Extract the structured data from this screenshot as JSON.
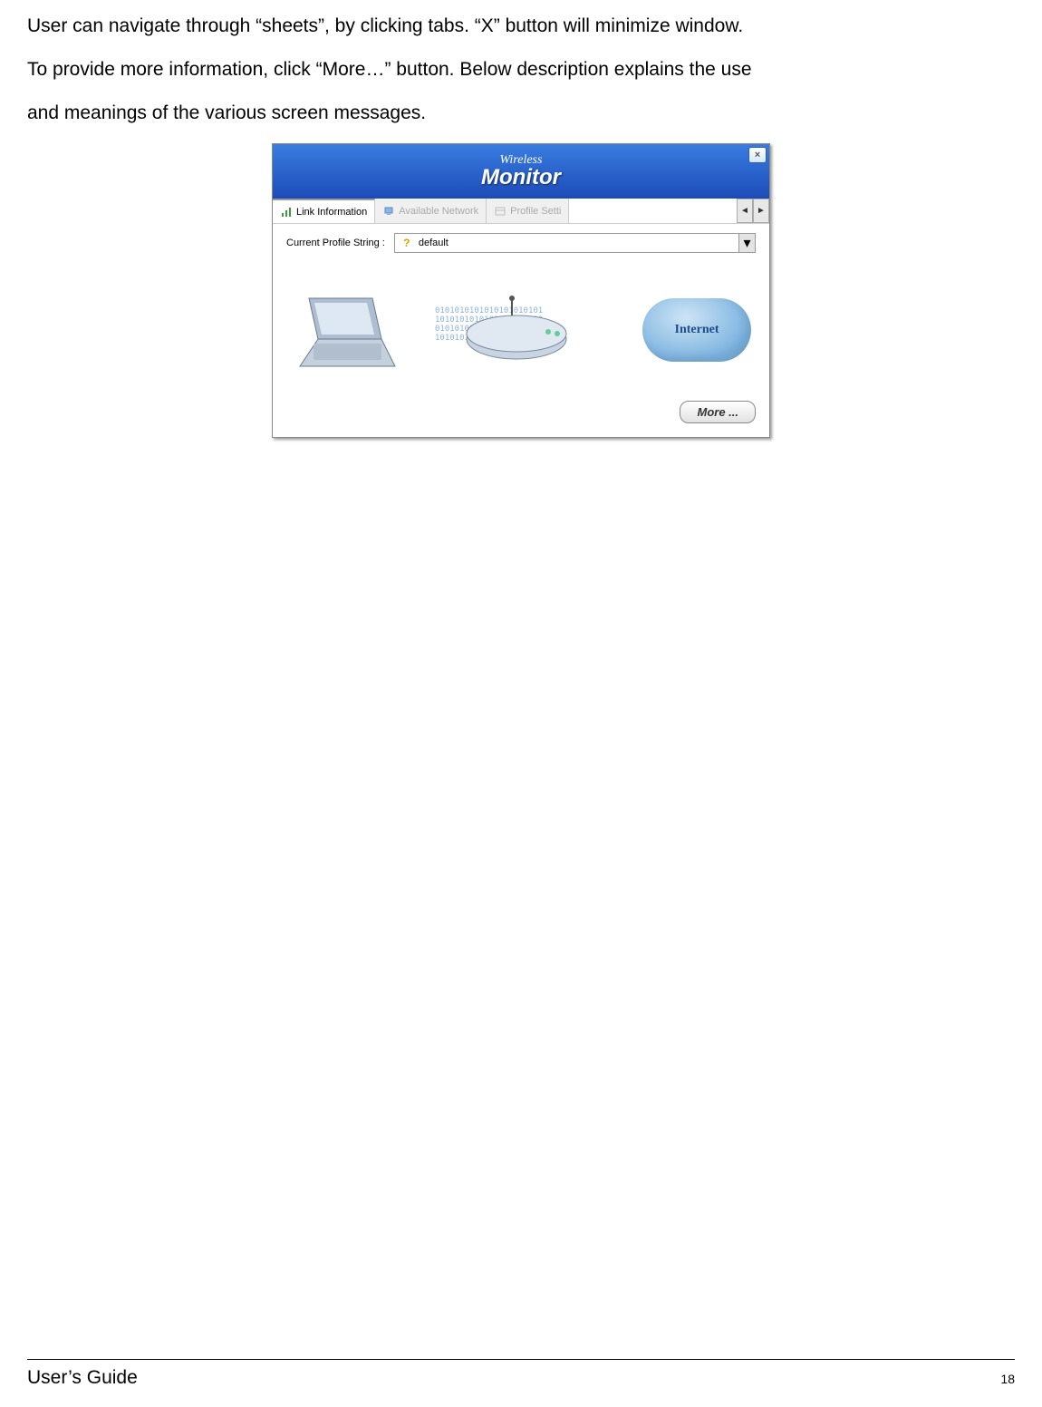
{
  "body": {
    "line1": "User can navigate through “sheets”, by clicking tabs.  “X” button will minimize window.",
    "line2": "To provide more information, click “More…” button. Below description explains the use",
    "line3": " and meanings of the various screen messages."
  },
  "window": {
    "title_wireless": "Wireless",
    "title_monitor": "Monitor",
    "close": "×",
    "tabs": {
      "link_info": "Link Information",
      "available_network": "Available Network",
      "profile_setting": "Profile Setti",
      "scroll_left": "◄",
      "scroll_right": "►"
    },
    "profile": {
      "label": "Current Profile String :",
      "value": "default",
      "arrow": "▾"
    },
    "diagram": {
      "binary": "0101010101010101010101\n1010101010101010101010\n0101010101010101010101\n1010101010101010101010",
      "internet_label": "Internet"
    },
    "more_label": "More ..."
  },
  "footer": {
    "title": "User’s Guide",
    "page": "18"
  }
}
